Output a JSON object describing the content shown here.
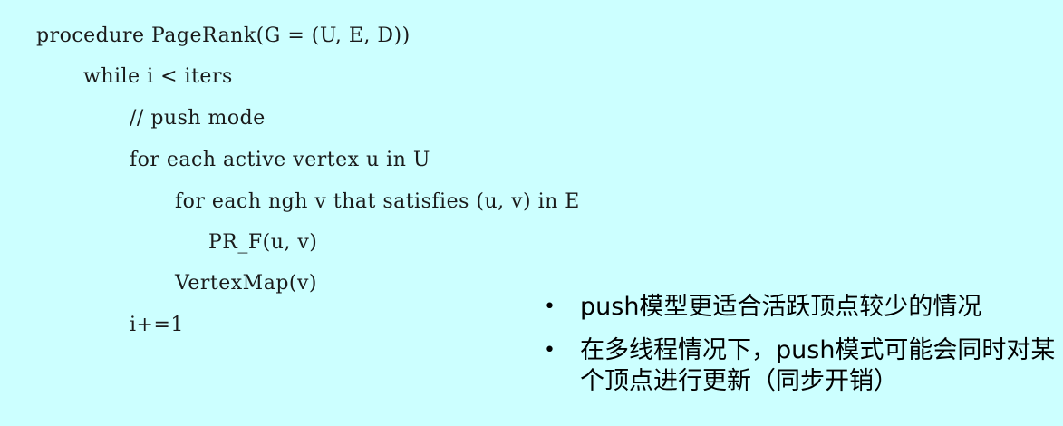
{
  "code": {
    "lines": [
      "procedure PageRank(G = (U, E, D))",
      "while i < iters",
      "// push mode",
      "for each active vertex u in U",
      "for each ngh v that satisfies (u, v) in E",
      "PR_F(u, v)",
      "VertexMap(v)",
      "i+=1"
    ]
  },
  "notes": {
    "bullet_symbol": "•",
    "items": [
      "push模型更适合活跃顶点较少的情况",
      "在多线程情况下，push模式可能会同时对某个顶点进行更新（同步开销）"
    ]
  }
}
